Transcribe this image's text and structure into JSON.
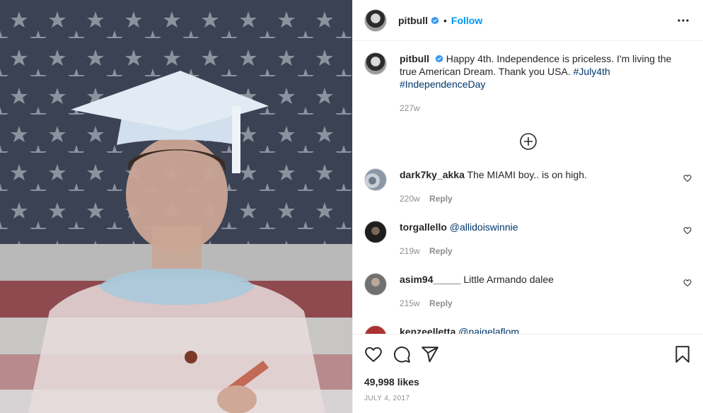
{
  "post": {
    "username": "pitbull",
    "follow_label": "Follow",
    "separator": "•",
    "caption_text": "Happy 4th. Independence is priceless. I'm living the true American Dream. Thank you USA. ",
    "hashtags": [
      "#July4th",
      "#IndependenceDay"
    ],
    "caption_time": "227w",
    "likes": "49,998 likes",
    "date": "July 4, 2017"
  },
  "comments": [
    {
      "username": "dark7ky_akka",
      "text": "The MIAMI boy.. is on high.",
      "time": "220w",
      "reply_label": "Reply"
    },
    {
      "username": "torgallello",
      "text": "@allidoiswinnie",
      "time": "219w",
      "reply_label": "Reply"
    },
    {
      "username": "asim94_____",
      "text": "Little Armando dalee",
      "time": "215w",
      "reply_label": "Reply"
    },
    {
      "username": "kenzeelletta",
      "text": "@naigelaflom"
    }
  ],
  "icons": {
    "verified": "verified-badge-icon",
    "more": "more-options-icon",
    "load_more": "load-more-comments-icon",
    "like": "heart-icon",
    "comment": "comment-icon",
    "share": "share-icon",
    "save": "bookmark-icon"
  },
  "colors": {
    "link": "#0095f6",
    "hashtag": "#00376b",
    "muted": "#8e8e8e",
    "text": "#262626"
  }
}
